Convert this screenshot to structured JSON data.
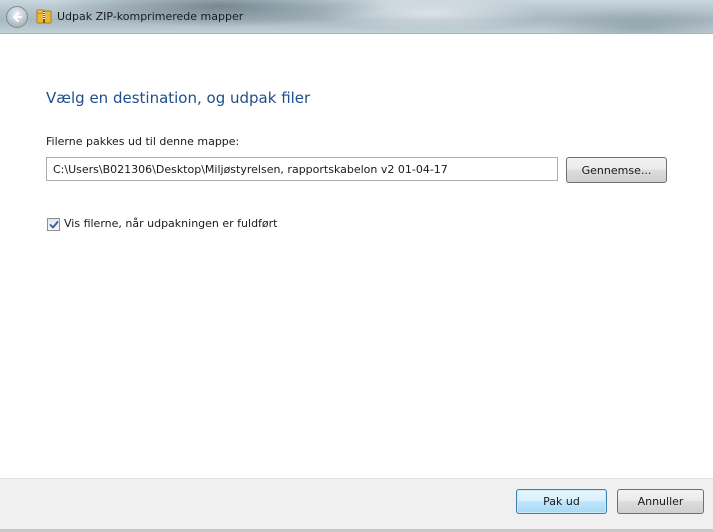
{
  "window": {
    "title": "Udpak ZIP-komprimerede mapper"
  },
  "icons": {
    "back": "back-arrow-icon",
    "title": "zip-folder-icon",
    "checkbox": "checkmark-icon"
  },
  "main": {
    "heading": "Vælg en destination, og udpak filer",
    "destination_label": "Filerne pakkes ud til denne mappe:",
    "destination_value": "C:\\Users\\B021306\\Desktop\\Miljøstyrelsen, rapportskabelon v2 01-04-17",
    "browse_label": "Gennemse...",
    "show_files_label": "Vis filerne, når udpakningen er fuldført",
    "show_files_checked": true
  },
  "footer": {
    "extract_label": "Pak ud",
    "cancel_label": "Annuller"
  },
  "colors": {
    "heading": "#1f4f8b",
    "footer_bg": "#f0f0f0"
  }
}
